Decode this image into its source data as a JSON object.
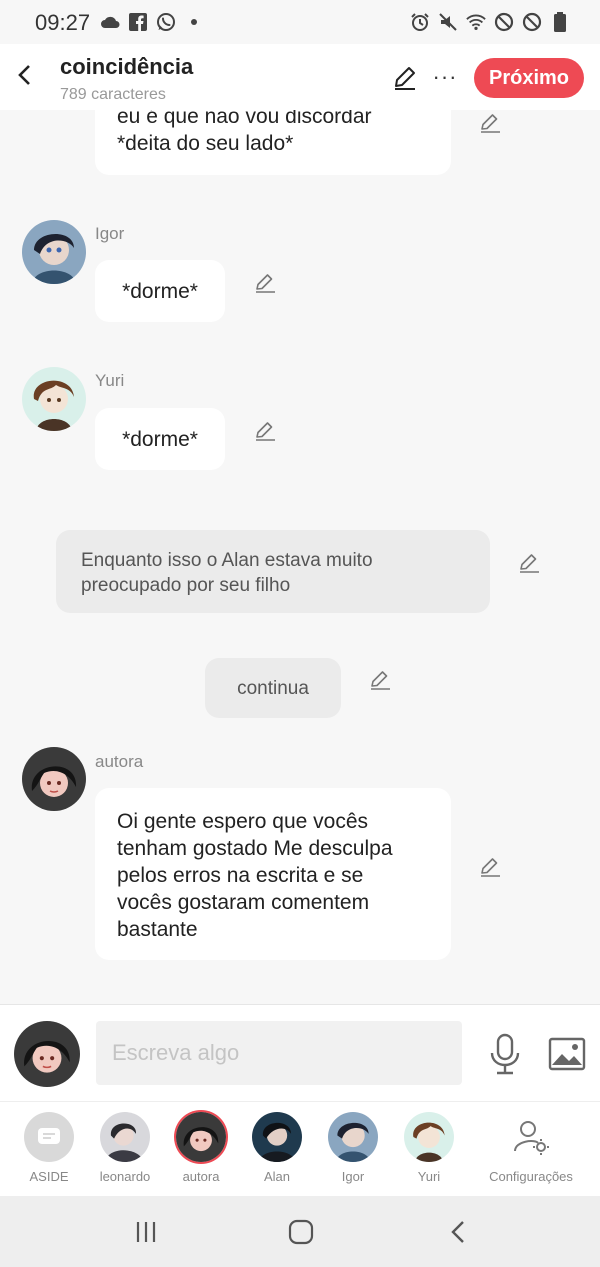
{
  "status": {
    "time": "09:27",
    "left_icons": [
      "cloud-icon",
      "facebook-icon",
      "whatsapp-icon",
      "dot-icon"
    ],
    "right_icons": [
      "alarm-icon",
      "mute-icon",
      "wifi-icon",
      "dnd-icon",
      "dnd-icon",
      "battery-icon"
    ]
  },
  "header": {
    "title": "coincidência",
    "subtitle": "789 caracteres",
    "next_label": "Próximo",
    "more_label": "···"
  },
  "colors": {
    "accent": "#ee4a54",
    "bubble": "#ffffff",
    "narration": "#ebebeb",
    "background": "#f7f7f7"
  },
  "messages": [
    {
      "type": "bubble",
      "lines": [
        "eu é que não vou discordar",
        "*deita do seu lado*"
      ]
    },
    {
      "type": "bubble",
      "speaker": "Igor",
      "text": "*dorme*"
    },
    {
      "type": "bubble",
      "speaker": "Yuri",
      "text": "*dorme*"
    },
    {
      "type": "narration",
      "lines": [
        "Enquanto isso o Alan estava muito",
        "preocupado por seu filho"
      ]
    },
    {
      "type": "narration",
      "text": "continua"
    },
    {
      "type": "bubble",
      "speaker": "autora",
      "lines": [
        "Oi gente espero que vocês",
        "tenham gostado Me desculpa",
        "pelos erros na escrita e se",
        "vocês gostaram comentem",
        "bastante"
      ]
    }
  ],
  "composer": {
    "placeholder": "Escreva algo"
  },
  "characters": [
    {
      "label": "ASIDE"
    },
    {
      "label": "leonardo"
    },
    {
      "label": "autora"
    },
    {
      "label": "Alan"
    },
    {
      "label": "Igor"
    },
    {
      "label": "Yuri"
    },
    {
      "label": "Configurações"
    }
  ]
}
